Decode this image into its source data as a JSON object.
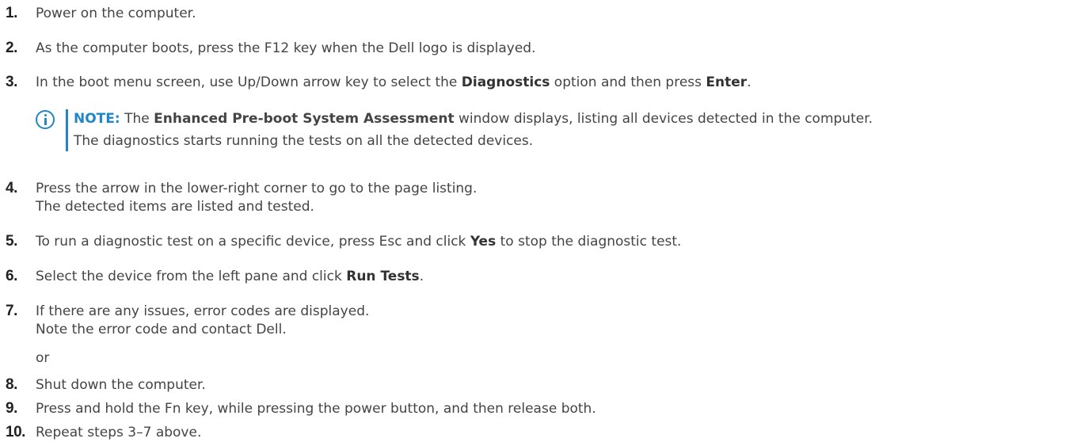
{
  "steps": [
    {
      "num": "1.",
      "text": "Power on the computer."
    },
    {
      "num": "2.",
      "text": "As the computer boots, press the F12 key when the Dell logo is displayed."
    },
    {
      "num": "3.",
      "pre": "In the boot menu screen, use Up/Down arrow key to select the ",
      "bold1": "Diagnostics",
      "mid": " option and then press ",
      "bold2": "Enter",
      "post": "."
    },
    {
      "num": "4.",
      "text": "Press the arrow in the lower-right corner to go to the page listing.",
      "text2": "The detected items are listed and tested."
    },
    {
      "num": "5.",
      "pre": "To run a diagnostic test on a specific device, press Esc and click ",
      "bold1": "Yes",
      "post": " to stop the diagnostic test."
    },
    {
      "num": "6.",
      "pre": "Select the device from the left pane and click ",
      "bold1": "Run Tests",
      "post": "."
    },
    {
      "num": "7.",
      "text": "If there are any issues, error codes are displayed.",
      "text2": "Note the error code and contact Dell.",
      "text3": "or"
    },
    {
      "num": "8.",
      "text": "Shut down the computer."
    },
    {
      "num": "9.",
      "text": "Press and hold the Fn key, while pressing the power button, and then release both."
    },
    {
      "num": "10.",
      "text": "Repeat steps 3–7 above."
    }
  ],
  "note": {
    "label": "NOTE:",
    "pre": " The ",
    "bold": "Enhanced Pre-boot System Assessment",
    "post": " window displays, listing all devices detected in the computer.",
    "line2": "The diagnostics starts running the tests on all the detected devices.",
    "icon": "info-icon",
    "accent": "#1f86c8"
  }
}
